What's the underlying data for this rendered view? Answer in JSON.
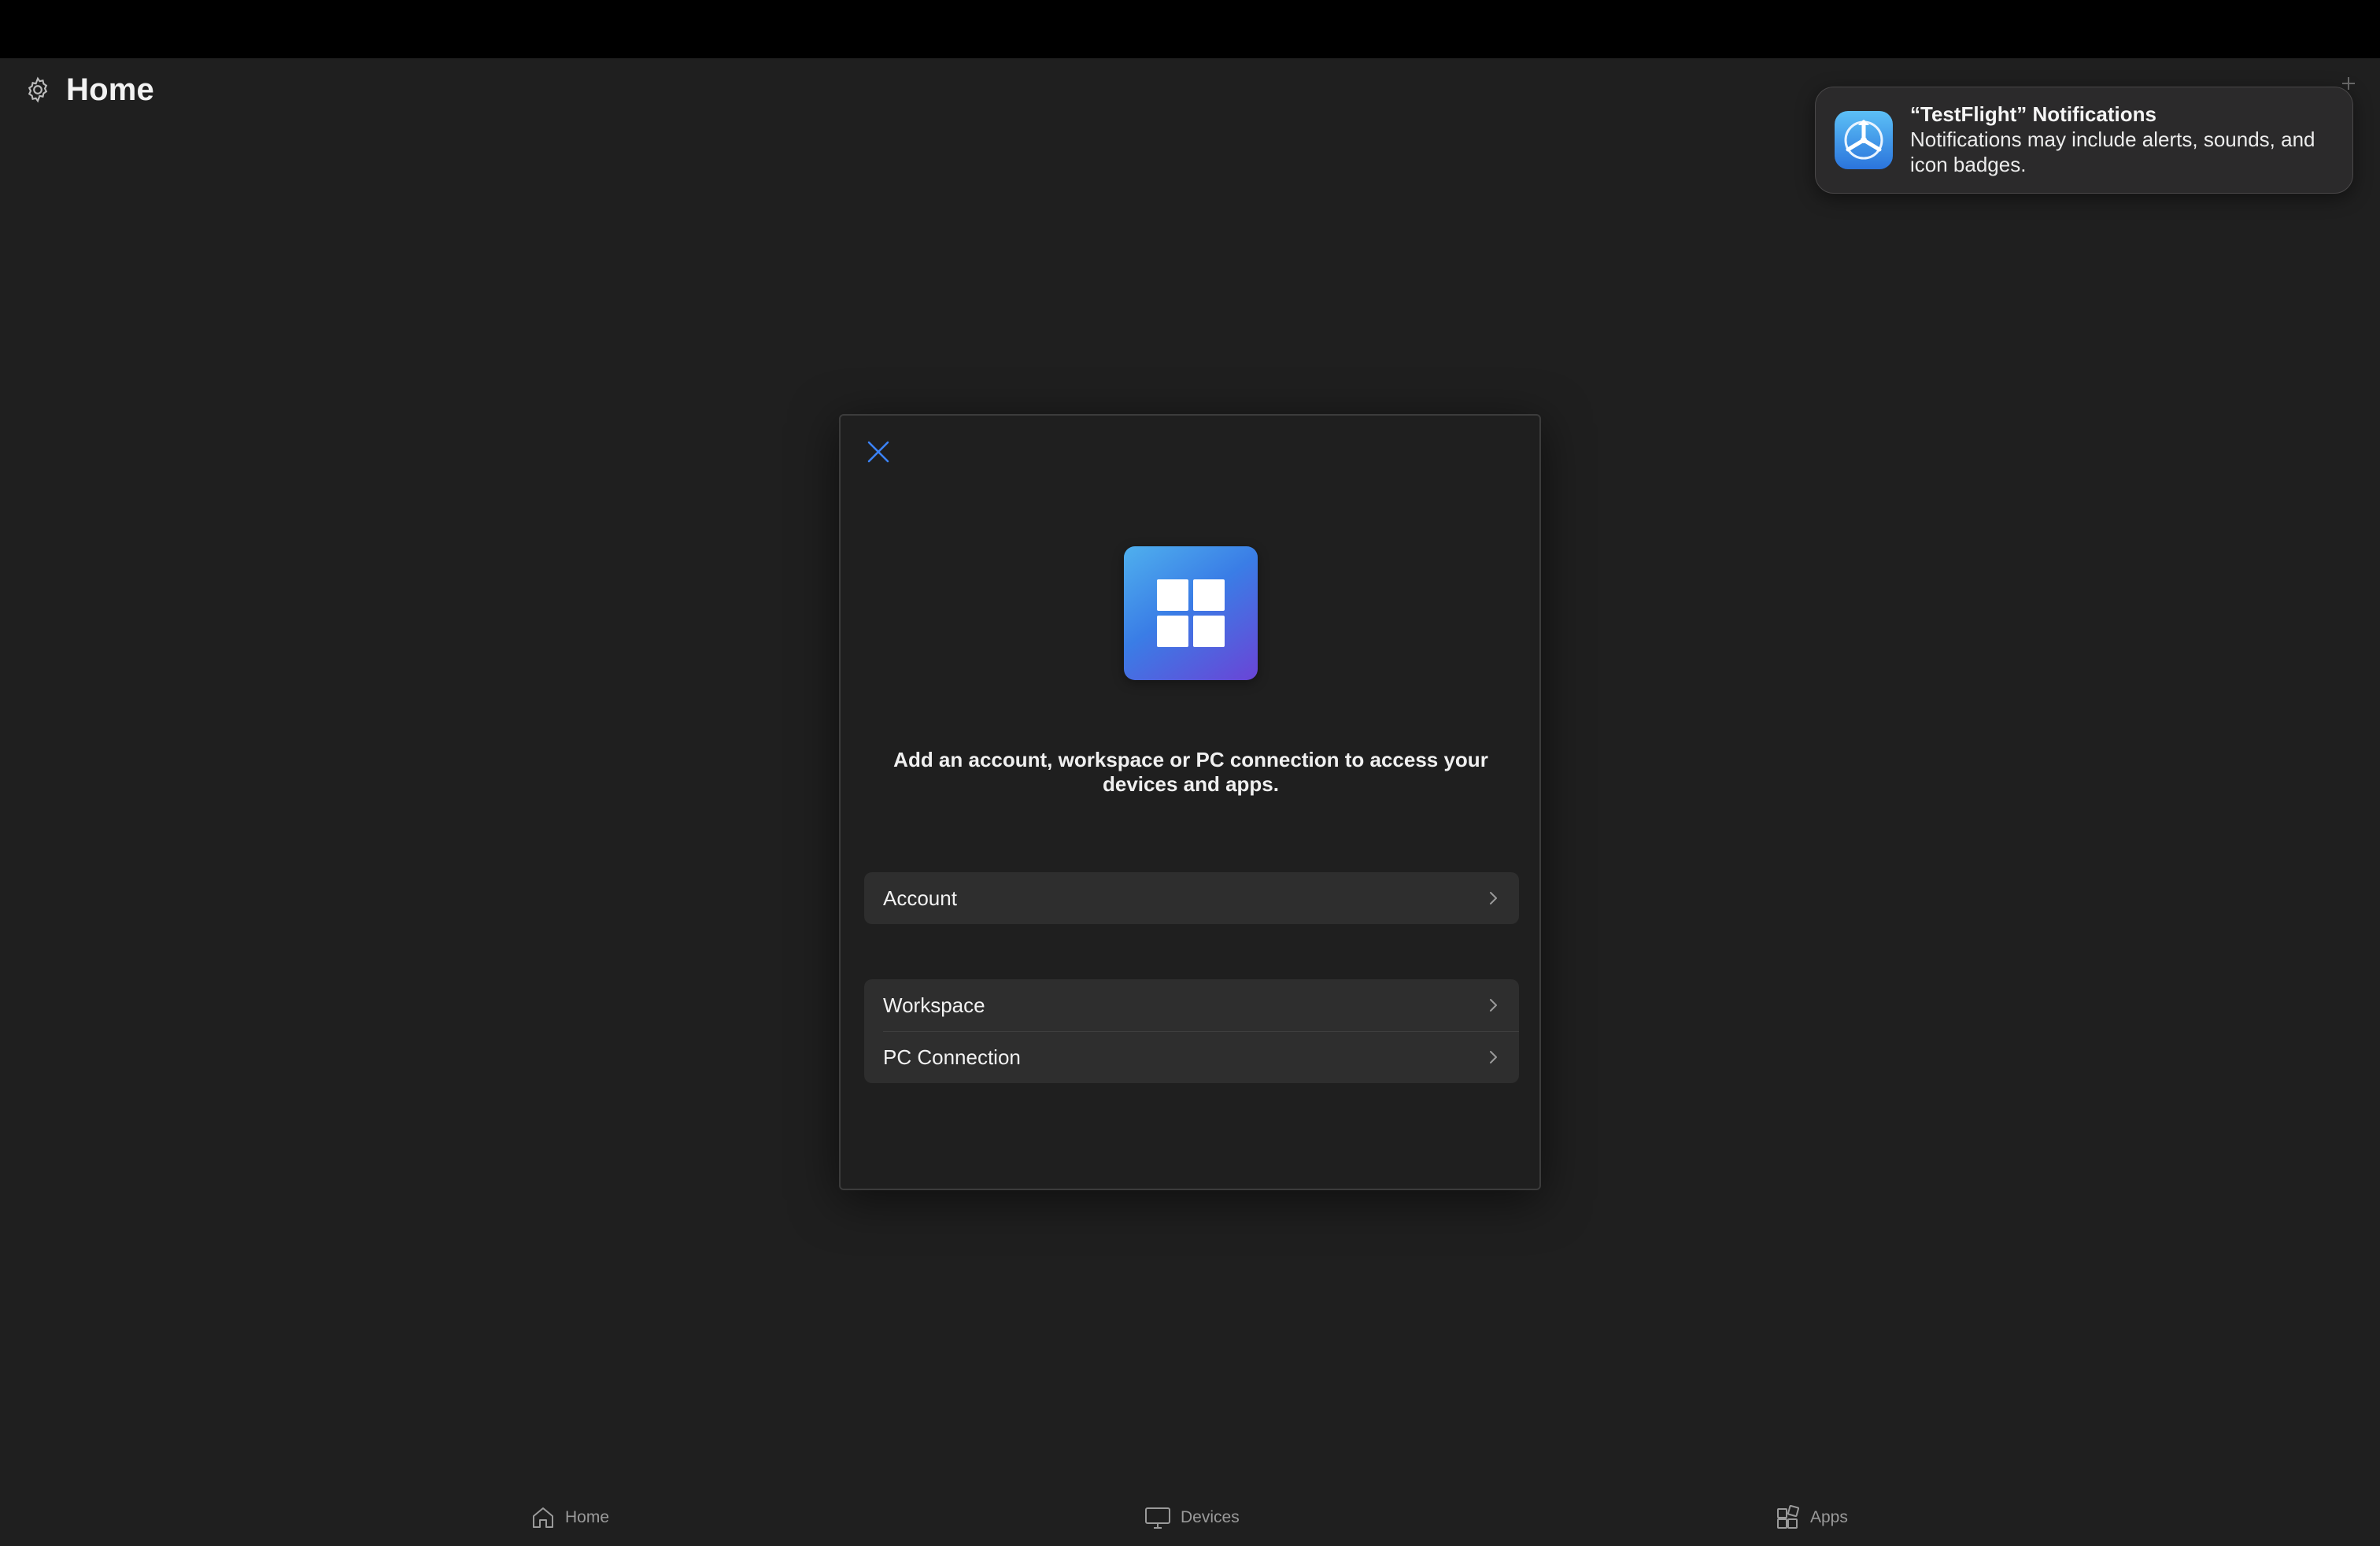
{
  "header": {
    "title": "Home",
    "settings_icon": "gear-icon"
  },
  "notification": {
    "app_icon": "testflight-icon",
    "title": "“TestFlight” Notifications",
    "body": "Notifications may include alerts, sounds, and icon badges."
  },
  "dialog": {
    "close_icon": "close-icon",
    "logo_icon": "windows-logo-icon",
    "prompt": "Add an account, workspace or PC connection to access your devices and apps.",
    "options_group1": [
      {
        "label": "Account"
      }
    ],
    "options_group2": [
      {
        "label": "Workspace"
      },
      {
        "label": "PC Connection"
      }
    ]
  },
  "tabbar": {
    "home": {
      "label": "Home",
      "icon": "house-icon"
    },
    "devices": {
      "label": "Devices",
      "icon": "monitor-icon"
    },
    "apps": {
      "label": "Apps",
      "icon": "apps-grid-icon"
    }
  },
  "colors": {
    "background": "#1f1f1f",
    "accent": "#3b82f6",
    "row": "#2e2e2e"
  }
}
